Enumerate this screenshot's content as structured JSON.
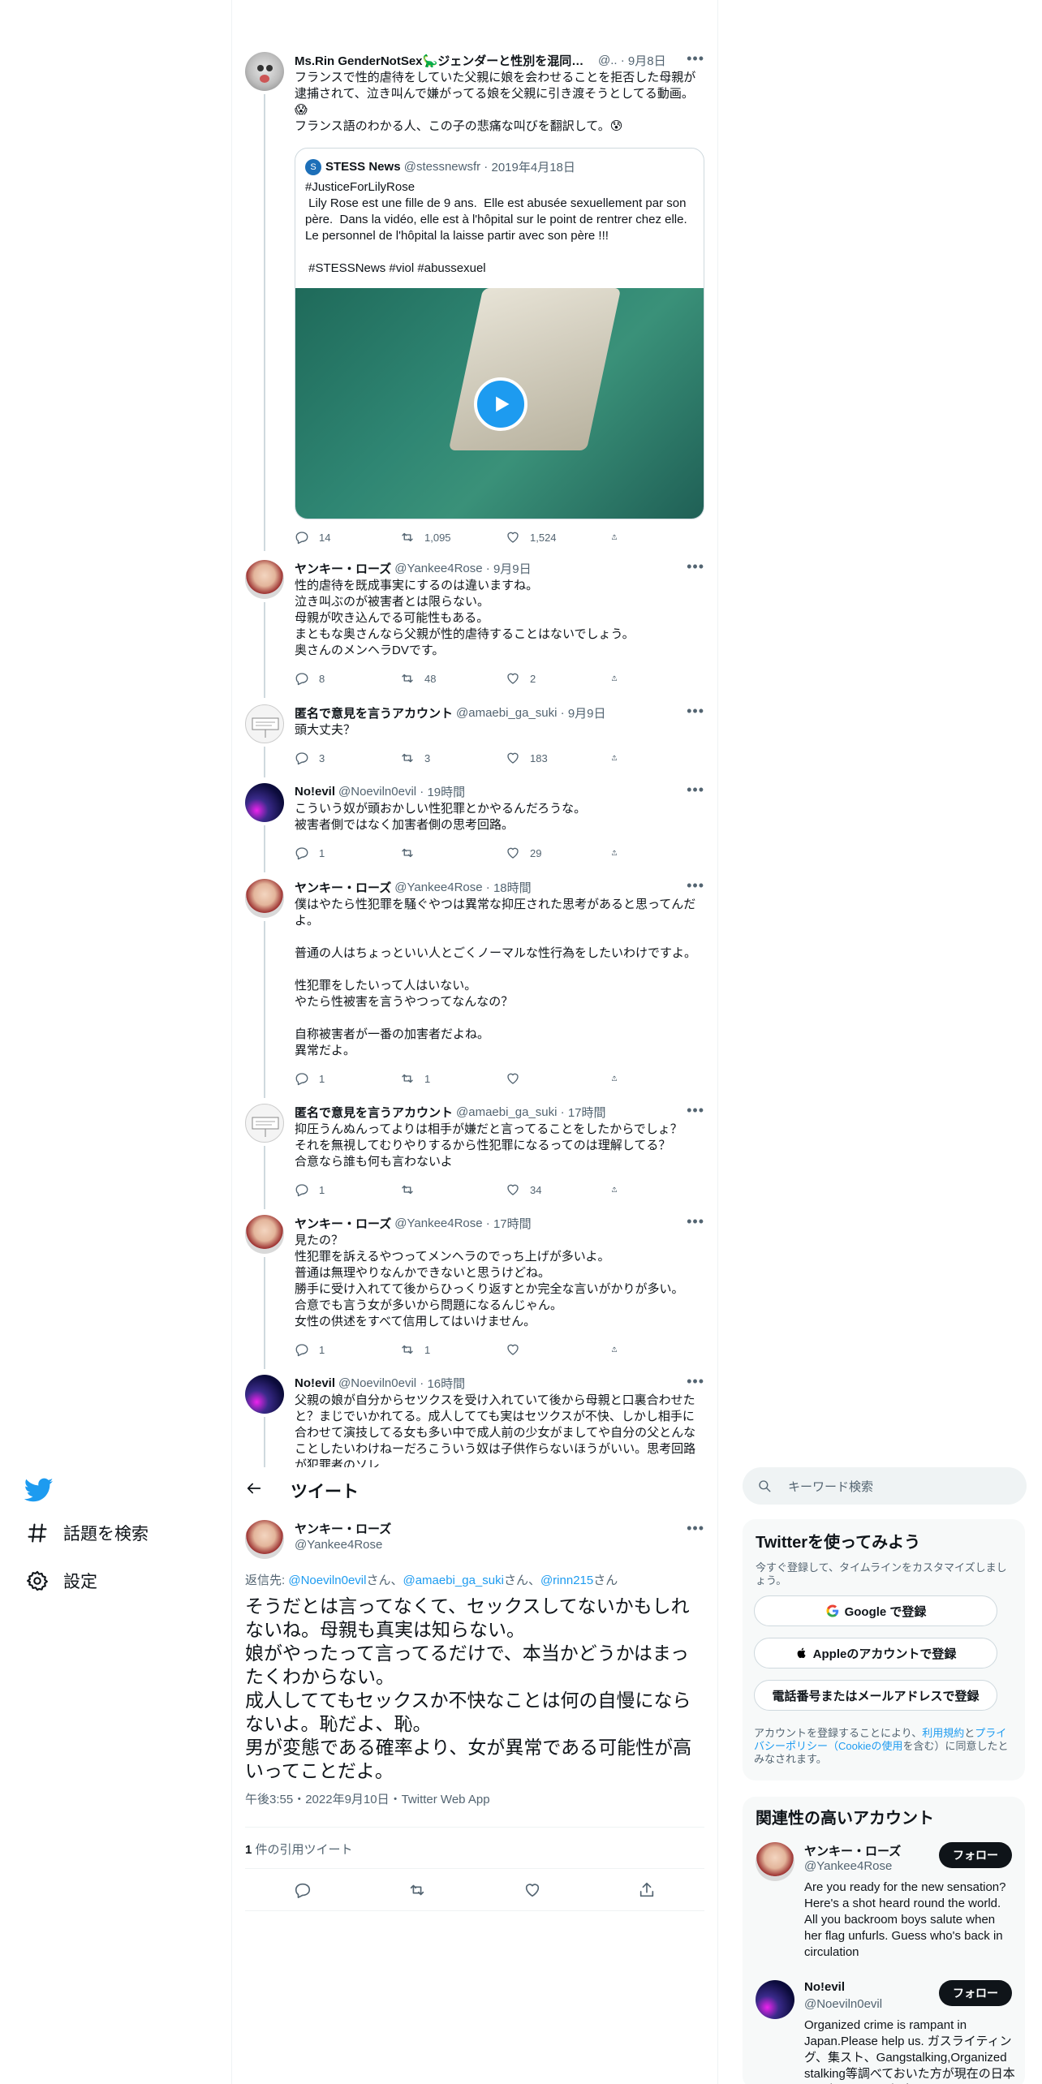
{
  "nav": {
    "items": [
      {
        "label": "話題を検索",
        "icon": "hashtag-icon"
      },
      {
        "label": "設定",
        "icon": "gear-icon"
      }
    ]
  },
  "thread": [
    {
      "name": "Ms.Rin GenderNotSex🦕ジェンダーと性別を混同注意...",
      "handle": "@..",
      "time": "9月8日",
      "text": "フランスで性的虐待をしていた父親に娘を会わせることを拒否した母親が逮捕されて、泣き叫んで嫌がってる娘を父親に引き渡そうとしてる動画。😱\nフランス語のわかる人、この子の悲痛な叫びを翻訳して。😰",
      "replies": "14",
      "retweets": "1,095",
      "likes": "1,524",
      "quote": {
        "name": "STESS News",
        "handle": "@stessnewsfr",
        "time": "2019年4月18日",
        "text": "#JusticeForLilyRose\n Lily Rose est une fille de 9 ans.  Elle est abusée sexuellement par son père.  Dans la vidéo, elle est à l'hôpital sur le point de rentrer chez elle. Le personnel de l'hôpital la laisse partir avec son père !!!\n\n #STESSNews #viol #abussexuel"
      }
    },
    {
      "name": "ヤンキー・ローズ",
      "handle": "@Yankee4Rose",
      "time": "9月9日",
      "text": "性的虐待を既成事実にするのは違いますね。\n泣き叫ぶのが被害者とは限らない。\n母親が吹き込んでる可能性もある。\nまともな奥さんなら父親が性的虐待することはないでしょう。\n奥さんのメンヘラDVです。",
      "replies": "8",
      "retweets": "48",
      "likes": "2"
    },
    {
      "name": "匿名で意見を言うアカウント",
      "handle": "@amaebi_ga_suki",
      "time": "9月9日",
      "text": "頭大丈夫？",
      "replies": "3",
      "retweets": "3",
      "likes": "183"
    },
    {
      "name": "No!evil",
      "handle": "@Noeviln0evil",
      "time": "19時間",
      "text": "こういう奴が頭おかしい性犯罪とかやるんだろうな。\n被害者側ではなく加害者側の思考回路。",
      "replies": "1",
      "retweets": "",
      "likes": "29"
    },
    {
      "name": "ヤンキー・ローズ",
      "handle": "@Yankee4Rose",
      "time": "18時間",
      "text": "僕はやたら性犯罪を騒ぐやつは異常な抑圧された思考があると思ってんだよ。\n\n普通の人はちょっといい人とごくノーマルな性行為をしたいわけですよ。\n\n性犯罪をしたいって人はいない。\nやたら性被害を言うやつってなんなの？\n\n自称被害者が一番の加害者だよね。\n異常だよ。",
      "replies": "1",
      "retweets": "1",
      "likes": ""
    },
    {
      "name": "匿名で意見を言うアカウント",
      "handle": "@amaebi_ga_suki",
      "time": "17時間",
      "text": "抑圧うんぬんってよりは相手が嫌だと言ってることをしたからでしょ？\nそれを無視してむりやりするから性犯罪になるってのは理解してる？\n合意なら誰も何も言わないよ",
      "replies": "1",
      "retweets": "",
      "likes": "34"
    },
    {
      "name": "ヤンキー・ローズ",
      "handle": "@Yankee4Rose",
      "time": "17時間",
      "text": "見たの？\n性犯罪を訴えるやつってメンヘラのでっち上げが多いよ。\n普通は無理やりなんかできないと思うけどね。\n勝手に受け入れてて後からひっくり返すとか完全な言いがかりが多い。\n合意でも言う女が多いから問題になるんじゃん。\n女性の供述をすべて信用してはいけません。",
      "replies": "1",
      "retweets": "1",
      "likes": ""
    },
    {
      "name": "No!evil",
      "handle": "@Noeviln0evil",
      "time": "16時間",
      "text": "父親の娘が自分からセツクスを受け入れていて後から母親と口裏合わせたと？まじでいかれてる。成人してても実はセツクスが不快、しかし相手に合わせて演技してる女も多い中で成人前の少女がましてや自分の父とんなことしたいわけねーだろこういう奴は子供作らないほうがいい。思考回路が犯罪者のソレ",
      "replies": "",
      "retweets": "",
      "likes": ""
    }
  ],
  "header": {
    "title": "ツイート"
  },
  "main_tweet": {
    "name": "ヤンキー・ローズ",
    "handle": "@Yankee4Rose",
    "reply_prefix": "返信先: ",
    "reply_to_1": "@Noeviln0evil",
    "reply_sep_1": "さん、",
    "reply_to_2": "@amaebi_ga_suki",
    "reply_sep_2": "さん、",
    "reply_to_3": "@rinn215",
    "reply_suffix": "さん",
    "text": "そうだとは言ってなくて、セックスしてないかもしれないね。母親も真実は知らない。\n娘がやったって言ってるだけで、本当かどうかはまったくわからない。\n成人しててもセックスか不快なことは何の自慢にならないよ。恥だよ、恥。\n男が変態である確率より、女が異常である可能性が高いってことだよ。",
    "timestamp": "午後3:55・2022年9月10日・Twitter Web App",
    "quote_count": "1",
    "quote_label": " 件の引用ツイート"
  },
  "sidebar": {
    "search_placeholder": "キーワード検索",
    "signup": {
      "title": "Twitterを使ってみよう",
      "subtitle": "今すぐ登録して、タイムラインをカスタマイズしましょう。",
      "google": "Google で登録",
      "apple": "Appleのアカウントで登録",
      "phone": "電話番号またはメールアドレスで登録",
      "terms_a": "アカウントを登録することにより、",
      "terms_link1": "利用規約",
      "terms_b": "と",
      "terms_link2": "プライバシーポリシー（Cookieの使用",
      "terms_c": "を含む）に同意したとみなされます。"
    },
    "related": {
      "title": "関連性の高いアカウント",
      "follow_label": "フォロー",
      "accounts": [
        {
          "name": "ヤンキー・ローズ",
          "handle": "@Yankee4Rose",
          "bio": "Are you ready for the new sensation? Here's a shot heard round the world. All you backroom boys salute when her flag unfurls. Guess who's back in circulation"
        },
        {
          "name": "No!evil",
          "handle": "@Noeviln0evil",
          "bio": "Organized crime is rampant in Japan.Please help us. ガスライティング、集スト、Gangstalking,Organized stalking等調べておいた方が現在の日本を理解するのに役立つでしょう。"
        }
      ]
    }
  },
  "colors": {
    "accent": "#1d9bf0",
    "text": "#0f1419",
    "muted": "#536471",
    "border": "#eff3f4"
  }
}
